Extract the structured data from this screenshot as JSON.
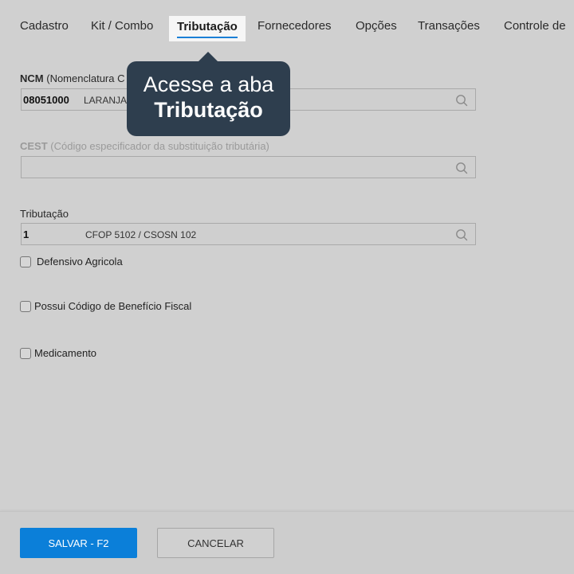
{
  "tabs": [
    {
      "label": "Cadastro"
    },
    {
      "label": "Kit / Combo"
    },
    {
      "label": "Tributação"
    },
    {
      "label": "Fornecedores"
    },
    {
      "label": "Opções"
    },
    {
      "label": "Transações"
    },
    {
      "label": "Controle de"
    }
  ],
  "ncm": {
    "label_strong": "NCM",
    "label_rest": "(Nomenclatura C",
    "code": "08051000",
    "desc": "LARANJA"
  },
  "cest": {
    "label_strong": "CEST",
    "label_rest": "(Código especificador da substituição tributária)",
    "code": "",
    "desc": ""
  },
  "tributacao": {
    "label": "Tributação",
    "code": "1",
    "desc": "CFOP 5102 / CSOSN 102"
  },
  "checks": [
    {
      "label": "Defensivo Agricola",
      "checked": false
    },
    {
      "label": "Possui Código de Benefício Fiscal",
      "checked": false
    },
    {
      "label": "Medicamento",
      "checked": false
    }
  ],
  "buttons": {
    "save": "SALVAR - F2",
    "cancel": "CANCELAR"
  },
  "tooltip": {
    "line1": "Acesse a aba",
    "line2": "Tributação"
  },
  "colors": {
    "accent": "#0b7fd9",
    "tooltip_bg": "#2e3e4e",
    "overlay_bg": "#d0d0d0"
  },
  "icons": {
    "field_search": "search-icon"
  }
}
